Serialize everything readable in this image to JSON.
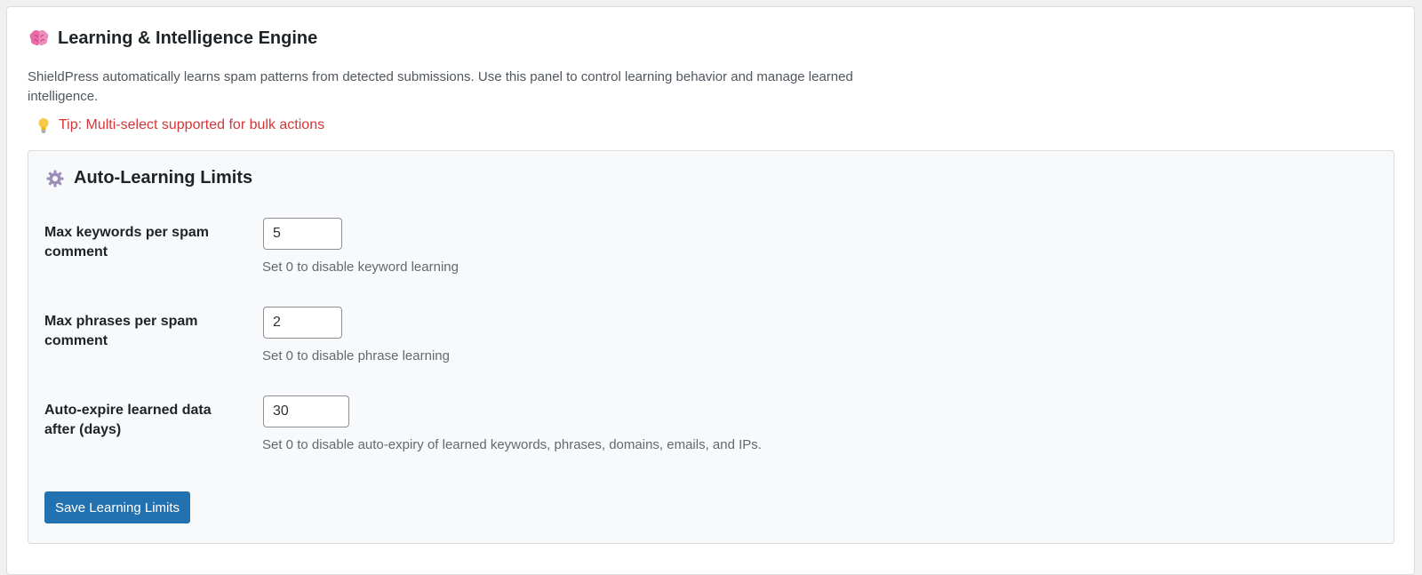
{
  "card": {
    "title": "Learning & Intelligence Engine",
    "description": "ShieldPress automatically learns spam patterns from detected submissions. Use this panel to control learning behavior and manage learned intelligence.",
    "tip": "Tip: Multi-select supported for bulk actions",
    "title_icon": "brain-icon",
    "tip_icon": "lightbulb-icon"
  },
  "panel": {
    "title": "Auto-Learning Limits",
    "title_icon": "gear-icon",
    "fields": [
      {
        "label": "Max keywords per spam comment",
        "value": "5",
        "help": "Set 0 to disable keyword learning"
      },
      {
        "label": "Max phrases per spam comment",
        "value": "2",
        "help": "Set 0 to disable phrase learning"
      },
      {
        "label": "Auto-expire learned data after (days)",
        "value": "30",
        "help": "Set 0 to disable auto-expiry of learned keywords, phrases, domains, emails, and IPs."
      }
    ],
    "save_label": "Save Learning Limits"
  },
  "colors": {
    "tip": "#d63638",
    "primary_button": "#2271b1",
    "panel_background": "#f8f9fb"
  }
}
